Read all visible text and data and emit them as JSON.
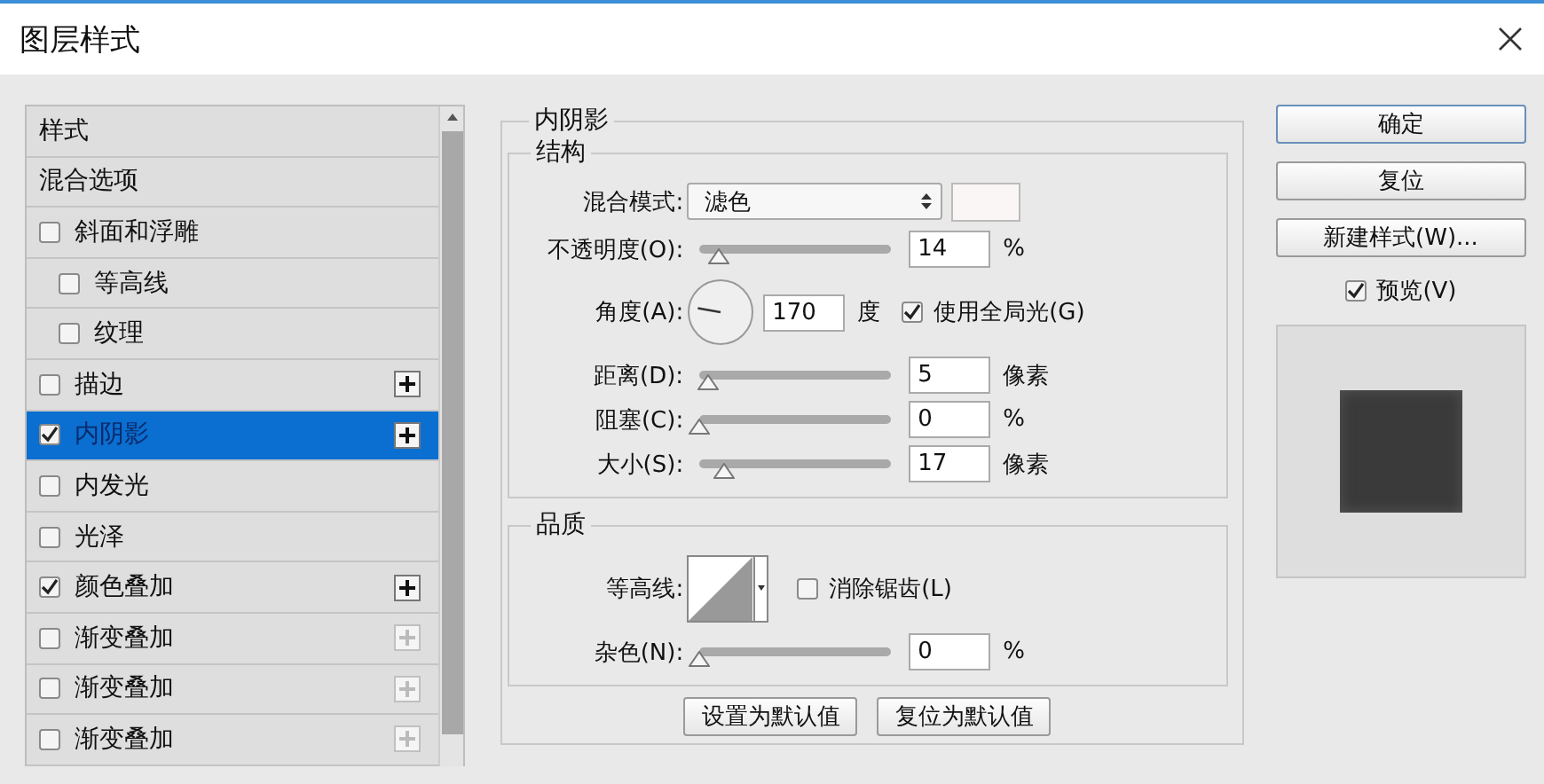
{
  "window": {
    "title": "图层样式"
  },
  "styles_list": {
    "items": [
      {
        "label": "样式",
        "kind": "header",
        "selected": false
      },
      {
        "label": "混合选项",
        "kind": "header",
        "selected": false
      },
      {
        "label": "斜面和浮雕",
        "kind": "checkbox",
        "checked": false,
        "selected": false,
        "children": [
          {
            "label": "等高线",
            "kind": "checkbox",
            "checked": false,
            "selected": false
          },
          {
            "label": "纹理",
            "kind": "checkbox",
            "checked": false,
            "selected": false
          }
        ]
      },
      {
        "label": "描边",
        "kind": "checkbox",
        "checked": false,
        "selected": false,
        "add_button": {
          "disabled": false
        }
      },
      {
        "label": "内阴影",
        "kind": "checkbox",
        "checked": true,
        "selected": true,
        "add_button": {
          "disabled": false
        }
      },
      {
        "label": "内发光",
        "kind": "checkbox",
        "checked": false,
        "selected": false
      },
      {
        "label": "光泽",
        "kind": "checkbox",
        "checked": false,
        "selected": false
      },
      {
        "label": "颜色叠加",
        "kind": "checkbox",
        "checked": true,
        "selected": false,
        "add_button": {
          "disabled": false
        }
      },
      {
        "label": "渐变叠加",
        "kind": "checkbox",
        "checked": false,
        "selected": false,
        "add_button": {
          "disabled": true
        }
      },
      {
        "label": "渐变叠加",
        "kind": "checkbox",
        "checked": false,
        "selected": false,
        "add_button": {
          "disabled": true
        }
      },
      {
        "label": "渐变叠加",
        "kind": "checkbox",
        "checked": false,
        "selected": false,
        "add_button": {
          "disabled": true
        }
      }
    ]
  },
  "effect": {
    "title": "内阴影",
    "structure": {
      "title": "结构",
      "rows": [
        {
          "kind": "select",
          "label": "混合模式:",
          "value": "滤色"
        },
        {
          "kind": "slider",
          "label": "不透明度(O):",
          "level": 0.1,
          "value": "14",
          "unit": "%"
        },
        {
          "kind": "angle",
          "label": "角度(A):",
          "value": "170",
          "unit": "度",
          "checkbox": {
            "label": "使用全局光(G)",
            "checked": true
          }
        },
        {
          "kind": "slider",
          "label": "距离(D):",
          "level": 0.05,
          "value": "5",
          "unit": "像素"
        },
        {
          "kind": "slider",
          "label": "阻塞(C):",
          "level": 0,
          "value": "0",
          "unit": "%"
        },
        {
          "kind": "slider",
          "label": "大小(S):",
          "level": 0.13,
          "value": "17",
          "unit": "像素"
        }
      ]
    },
    "quality": {
      "title": "品质",
      "rows": [
        {
          "kind": "contour",
          "label": "等高线:",
          "checkbox": {
            "label": "消除锯齿(L)",
            "checked": false
          }
        },
        {
          "kind": "slider",
          "label": "杂色(N):",
          "level": 0,
          "value": "0",
          "unit": "%"
        }
      ]
    },
    "buttons": [
      "设置为默认值",
      "复位为默认值"
    ]
  },
  "actions": {
    "buttons": [
      {
        "label": "确定",
        "default": true
      },
      {
        "label": "复位",
        "default": false
      },
      {
        "label": "新建样式(W)...",
        "default": false
      }
    ],
    "preview": {
      "label": "预览(V)",
      "checked": true
    }
  }
}
